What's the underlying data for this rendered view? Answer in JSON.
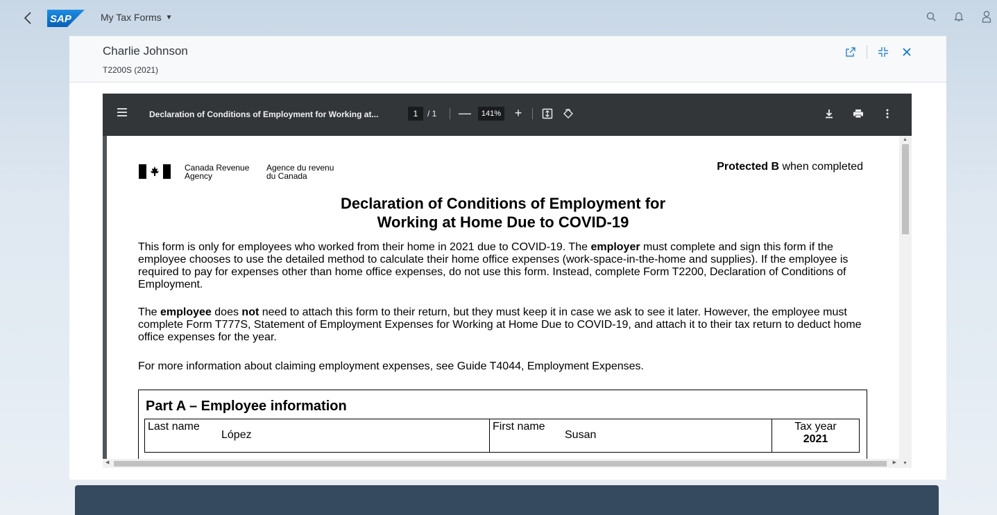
{
  "shell": {
    "app_title": "My Tax Forms",
    "logo_text": "SAP"
  },
  "object": {
    "title": "Charlie Johnson",
    "subtitle": "T2200S (2021)"
  },
  "viewer": {
    "doc_title": "Declaration of Conditions of Employment for Working at...",
    "page_current": "1",
    "page_total": "/ 1",
    "zoom": "141%",
    "zoom_out": "—",
    "zoom_in": "+"
  },
  "form": {
    "agency_en_line1": "Canada Revenue",
    "agency_en_line2": "Agency",
    "agency_fr_line1": "Agence du revenu",
    "agency_fr_line2": "du Canada",
    "protected_bold": "Protected B",
    "protected_rest": " when completed",
    "title_line1": "Declaration of Conditions of Employment for",
    "title_line2": "Working at Home Due to COVID-19",
    "p1_a": "This form is only for employees who worked from their home in 2021 due to COVID-19. The ",
    "p1_b": "employer",
    "p1_c": " must complete and sign this form if the employee chooses to use the detailed method to calculate their home office expenses (work-space-in-the-home and supplies). If the employee is required to pay for expenses other than home office expenses, do not use this form. Instead, complete Form T2200, Declaration of Conditions of Employment.",
    "p2_a": "The ",
    "p2_b": "employee",
    "p2_c": " does ",
    "p2_d": "not",
    "p2_e": " need to attach this form to their return, but they must keep it in case we ask to see it later. However, the employee must complete Form T777S, Statement of Employment Expenses for Working at Home Due to COVID-19, and attach it to their tax return to deduct home office expenses for the year.",
    "p3": "For more information about claiming employment expenses, see Guide T4044, Employment Expenses.",
    "partA_title": "Part A – Employee information",
    "last_name_label": "Last name",
    "last_name_value": "López",
    "first_name_label": "First name",
    "first_name_value": "Susan",
    "tax_year_label": "Tax year",
    "tax_year_value": "2021"
  },
  "colors": {
    "shell_bg": "#c8d7e6",
    "toolbar_bg": "#323639",
    "viewer_bg": "#525659",
    "footer_bar": "#354a5f",
    "logo_blue": "#0a6ed1"
  },
  "icons": [
    "back-icon",
    "search-icon",
    "bell-icon",
    "user-icon",
    "open-external-icon",
    "exit-fullscreen-icon",
    "close-icon",
    "hamburger-icon",
    "fit-page-icon",
    "rotate-icon",
    "download-icon",
    "print-icon",
    "more-icon"
  ]
}
